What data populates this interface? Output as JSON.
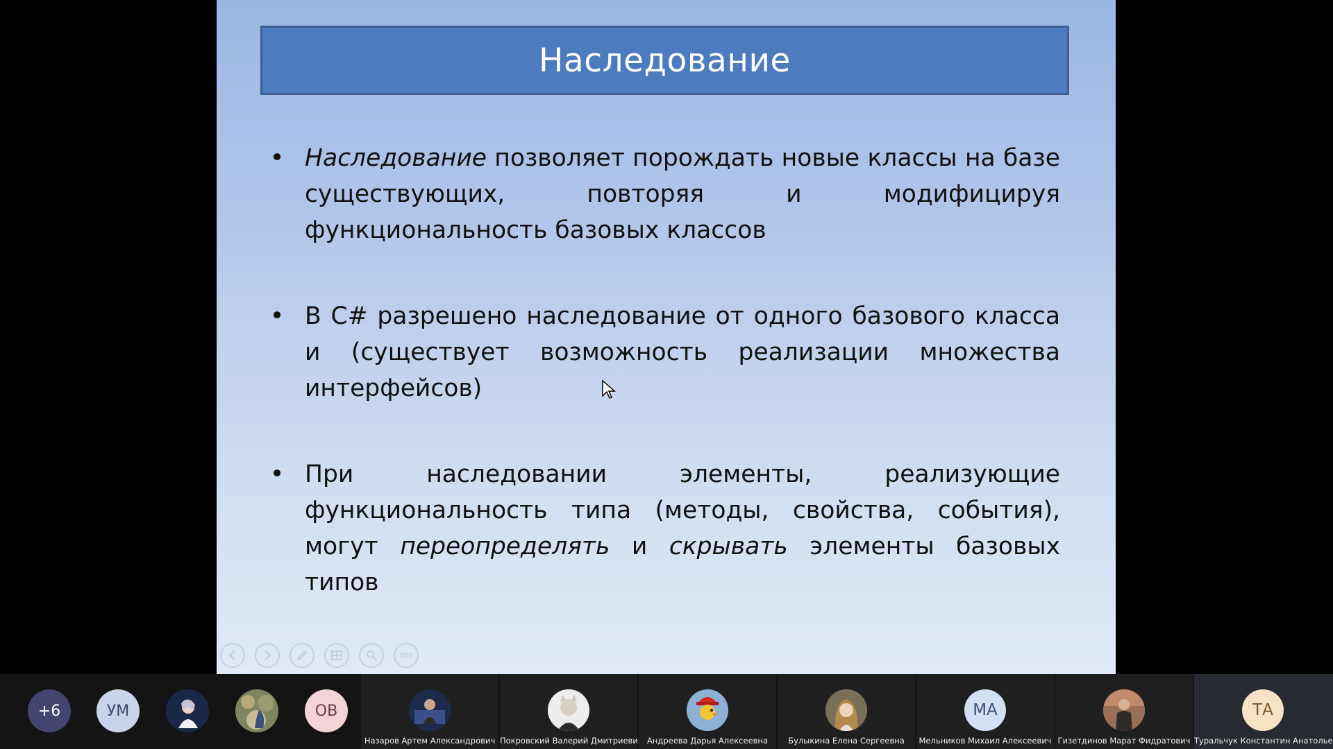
{
  "slide": {
    "title": "Наследование",
    "bullet1": {
      "italic_term": "Наследование",
      "text": " позволяет порождать новые классы на базе существующих, повторяя и модифицируя функциональность базовых классов"
    },
    "bullet2": {
      "text": "В C# разрешено наследование от одного базового класса и (существует возможность реализации множества интерфейсов)"
    },
    "bullet3": {
      "part1": "При наследовании элементы, реализующие функциональность типа (методы, свойства, события), могут ",
      "italic1": "переопределять",
      "part2": " и ",
      "italic2": "скрывать",
      "part3": " элементы базовых типов"
    },
    "bullet_glyph": "•",
    "controls": [
      "previous-icon",
      "next-icon",
      "pen-icon",
      "slides-grid-icon",
      "zoom-icon",
      "more-icon"
    ]
  },
  "participants": {
    "overflow_count": "+6",
    "small": [
      {
        "initials": "УМ",
        "color": "#c9d3ea"
      },
      {
        "initials": "",
        "kind": "photo"
      },
      {
        "initials": "",
        "kind": "photo"
      },
      {
        "initials": "ОВ",
        "color": "#f3d2d8"
      }
    ],
    "tiles": [
      {
        "name": "Назаров Артем Александрович",
        "initials": ""
      },
      {
        "name": "Покровский Валерий Дмитриевич",
        "initials": ""
      },
      {
        "name": "Андреева Дарья Алексеевна",
        "initials": ""
      },
      {
        "name": "Булыкина Елена Сергеевна",
        "initials": ""
      },
      {
        "name": "Мельников Михаил Алексеевич",
        "initials": "МА"
      },
      {
        "name": "Гизетдинов Марат Фидратович",
        "initials": ""
      },
      {
        "name": "Турaльчук Константин Анатольевич",
        "initials": "ТА"
      }
    ]
  },
  "colors": {
    "title_bar": "#4c7cbd",
    "overflow_badge": "#43456e",
    "ma_avatar": "#d3dff2",
    "ta_avatar": "#f6e3c6"
  }
}
